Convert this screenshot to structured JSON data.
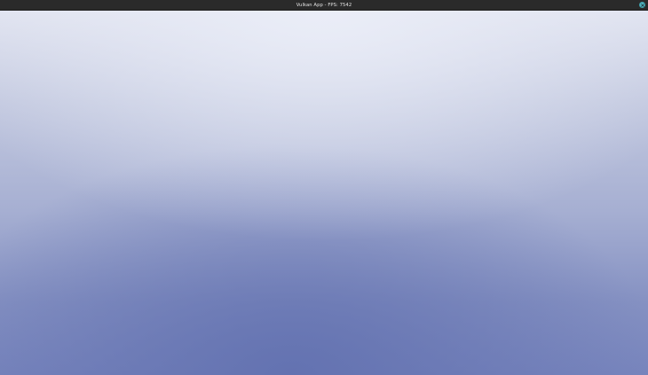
{
  "window": {
    "title": "Vulkan App - FPS: 7542"
  },
  "colors": {
    "titlebar": "#2a2a2a",
    "close_button": "#4fb3bf",
    "gradient_top": "#e8ebf6",
    "gradient_bottom": "#6472b0"
  },
  "icons": {
    "close": "close-icon"
  }
}
